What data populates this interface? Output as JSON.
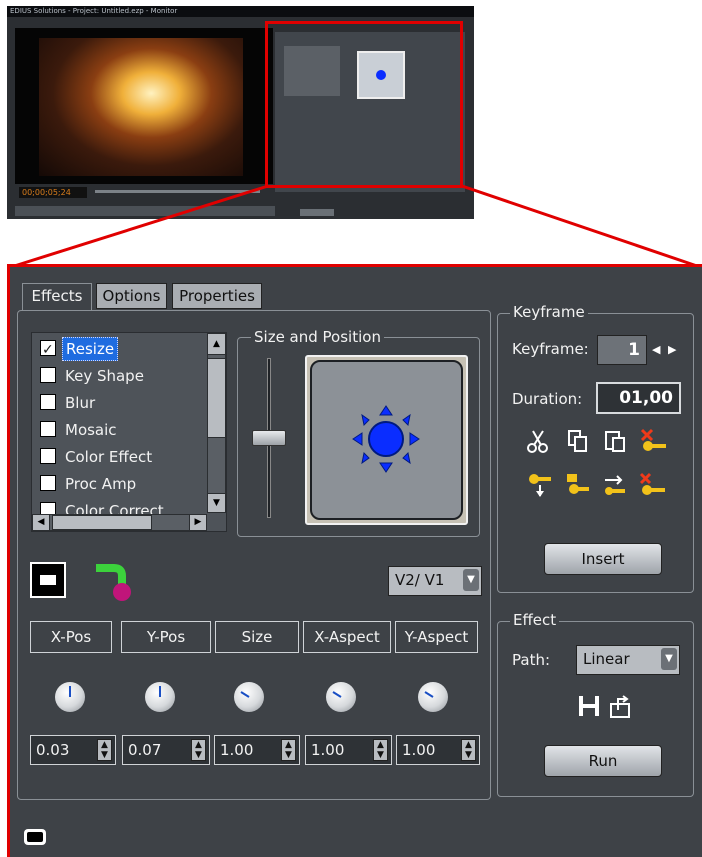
{
  "thumbnail": {
    "title": "EDIUS Solutions - Project: Untitled.ezp - Monitor",
    "timecode": "00;00;05;24"
  },
  "tabs": [
    "Effects",
    "Options",
    "Properties"
  ],
  "effects_list": [
    {
      "label": "Resize",
      "checked": true,
      "selected": true
    },
    {
      "label": "Key Shape",
      "checked": false
    },
    {
      "label": "Blur",
      "checked": false
    },
    {
      "label": "Mosaic",
      "checked": false
    },
    {
      "label": "Color Effect",
      "checked": false
    },
    {
      "label": "Proc Amp",
      "checked": false
    },
    {
      "label": "Color Correct",
      "checked": false
    }
  ],
  "size_position": {
    "title": "Size and Position"
  },
  "track_select": {
    "value": "V2/ V1"
  },
  "param_headers": [
    "X-Pos",
    "Y-Pos",
    "Size",
    "X-Aspect",
    "Y-Aspect"
  ],
  "param_values": [
    "0.03",
    "0.07",
    "1.00",
    "1.00",
    "1.00"
  ],
  "keyframe": {
    "title": "Keyframe",
    "keyframe_label": "Keyframe:",
    "keyframe_value": "1",
    "duration_label": "Duration:",
    "duration_value": "01,00",
    "insert_label": "Insert",
    "tool_icons_row1": [
      "scissors-icon",
      "copy-icon",
      "paste-icon",
      "delete-keyframe-icon"
    ],
    "tool_icons_row2": [
      "add-keyframe-icon",
      "key-insert-icon",
      "key-swap-icon",
      "key-remove-icon"
    ]
  },
  "effect": {
    "title": "Effect",
    "path_label": "Path:",
    "path_value": "Linear",
    "run_label": "Run"
  },
  "colors": {
    "highlight": "#e00000",
    "panel_bg": "#3e4247",
    "selection": "#1f6ce0",
    "preview_dot": "#0a2dff"
  }
}
